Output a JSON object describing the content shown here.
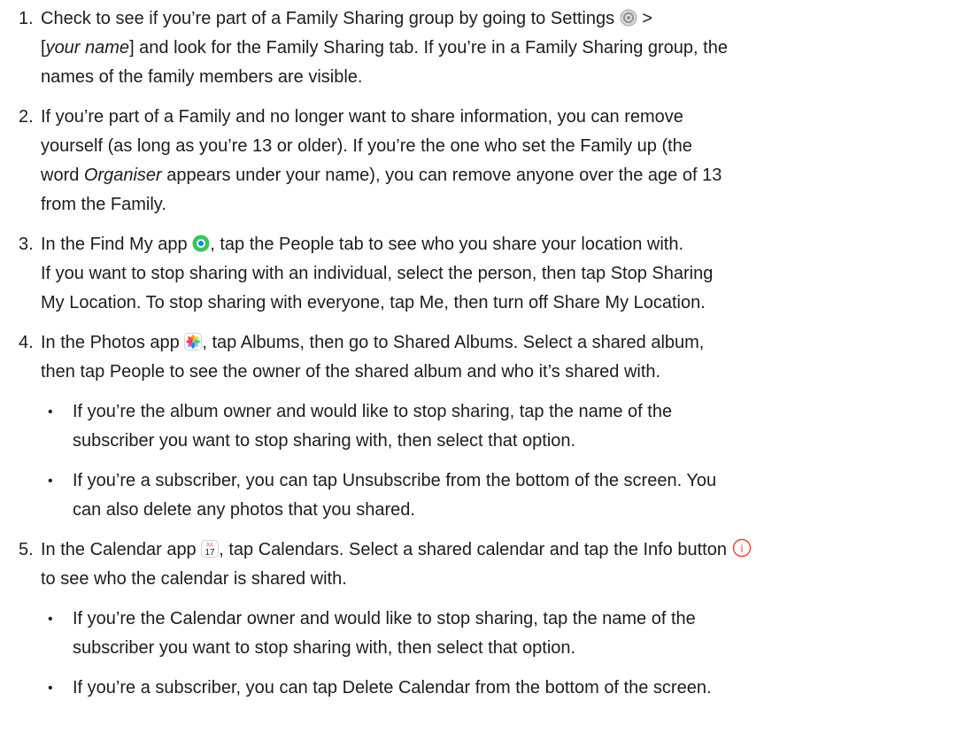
{
  "steps": [
    {
      "number": "1.",
      "lines": [
        [
          "Check to see if you’re part of a Family Sharing group by going to Settings",
          ">"
        ],
        [
          "[",
          "your name",
          "] and look for the Family Sharing tab. If you’re in a Family Sharing group, the"
        ],
        [
          "names of the family members are visible."
        ]
      ]
    },
    {
      "number": "2.",
      "lines": [
        [
          "If you’re part of a Family and no longer want to share information, you can remove"
        ],
        [
          "yourself (as long as you’re 13 or older). If you’re the one who set the Family up (the"
        ],
        [
          "word ",
          "Organiser",
          " appears under your name), you can remove anyone over the age of 13"
        ],
        [
          "from the Family."
        ]
      ]
    },
    {
      "number": "3.",
      "lines": [
        [
          "In the Find My app",
          ", tap the People tab to see who you share your location with."
        ],
        [
          "If you want to stop sharing with an individual, select the person, then tap Stop Sharing"
        ],
        [
          "My Location. To stop sharing with everyone, tap Me, then turn off Share My Location."
        ]
      ]
    },
    {
      "number": "4.",
      "lines": [
        [
          "In the Photos app",
          ", tap Albums, then go to Shared Albums. Select a shared album,"
        ],
        [
          "then tap People to see the owner of the shared album and who it’s shared with."
        ]
      ],
      "bullets": [
        {
          "lines": [
            [
              "If you’re the album owner and would like to stop sharing, tap the name of the"
            ],
            [
              "subscriber you want to stop sharing with, then select that option."
            ]
          ]
        },
        {
          "lines": [
            [
              "If you’re a subscriber, you can tap Unsubscribe from the bottom of the screen. You"
            ],
            [
              "can also delete any photos that you shared."
            ]
          ]
        }
      ]
    },
    {
      "number": "5.",
      "lines": [
        [
          "In the Calendar app",
          ", tap Calendars. Select a shared calendar and tap the Info button"
        ],
        [
          "to see who the calendar is shared with."
        ]
      ],
      "bullets": [
        {
          "lines": [
            [
              "If you’re the Calendar owner and would like to stop sharing, tap the name of the"
            ],
            [
              "subscriber you want to stop sharing with, then select that option."
            ]
          ]
        },
        {
          "lines": [
            [
              "If you’re a subscriber, you can tap Delete Calendar from the bottom of the screen."
            ]
          ]
        }
      ]
    }
  ],
  "bullet_glyph": "•",
  "icons": {
    "settings": "settings-gear-icon",
    "findmy": "find-my-icon",
    "photos": "photos-flower-icon",
    "calendar": "calendar-icon",
    "calendar_month": "JUL",
    "calendar_day": "17",
    "info": "info-circle-icon",
    "info_glyph": "i",
    "info_color": "#ff3b30"
  }
}
